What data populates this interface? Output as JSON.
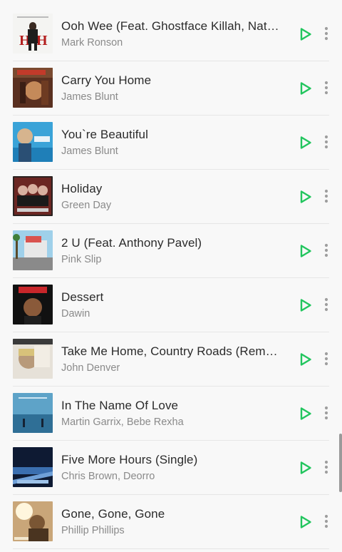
{
  "accent": "#22c55e",
  "icons": {
    "play": "play-triangle-outline-icon",
    "more": "vertical-dots-icon"
  },
  "songs": [
    {
      "title": "Ooh Wee (Feat. Ghostface Killah, Nat…",
      "artist": "Mark Ronson"
    },
    {
      "title": "Carry You Home",
      "artist": "James Blunt"
    },
    {
      "title": "You`re Beautiful",
      "artist": "James Blunt"
    },
    {
      "title": "Holiday",
      "artist": "Green Day"
    },
    {
      "title": "2 U (Feat. Anthony Pavel)",
      "artist": "Pink Slip"
    },
    {
      "title": "Dessert",
      "artist": "Dawin"
    },
    {
      "title": "Take Me Home, Country Roads (Rem…",
      "artist": "John Denver"
    },
    {
      "title": "In The Name Of Love",
      "artist": "Martin Garrix, Bebe Rexha"
    },
    {
      "title": "Five More Hours (Single)",
      "artist": "Chris Brown, Deorro"
    },
    {
      "title": "Gone, Gone, Gone",
      "artist": "Phillip Phillips"
    }
  ]
}
